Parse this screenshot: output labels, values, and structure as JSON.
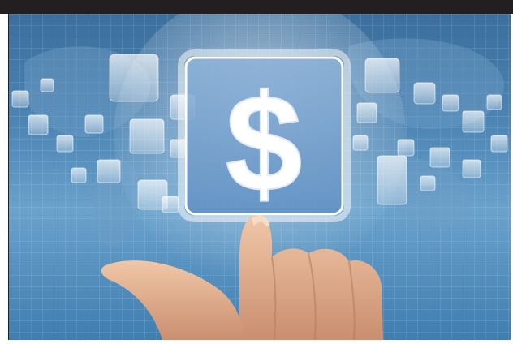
{
  "image": {
    "main_symbol": "$",
    "main_icon": "dollar-icon",
    "colors": {
      "top_bar": "#231f20",
      "sky_blue": "#4e86b5",
      "deep_blue": "#3b6e9c",
      "icon_glow": "#ffffff",
      "skin": "#e9b99a"
    }
  }
}
